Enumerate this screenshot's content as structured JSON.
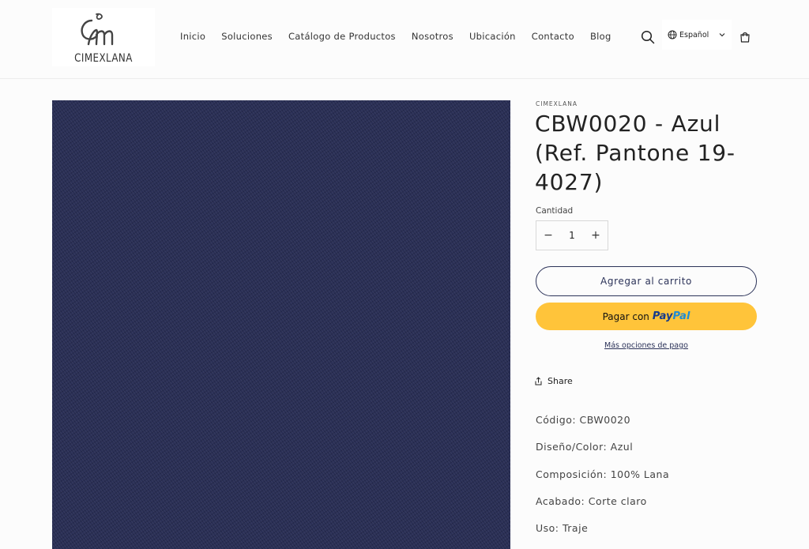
{
  "header": {
    "logo_text": "CIMEXLANA",
    "nav": [
      "Inicio",
      "Soluciones",
      "Catálogo de Productos",
      "Nosotros",
      "Ubicación",
      "Contacto",
      "Blog"
    ],
    "language": "Español",
    "icons": {
      "search": "search-icon",
      "language": "globe-icon",
      "dropdown": "chevron-down-icon",
      "cart": "cart-icon"
    }
  },
  "product": {
    "vendor": "CIMEXLANA",
    "title": "CBW0020 - Azul (Ref. Pantone 19-4027)",
    "image_color": "#2a2f55",
    "quantity_label": "Cantidad",
    "quantity": "1",
    "decrease_label": "−",
    "increase_label": "+",
    "add_to_cart": "Agregar al carrito",
    "paypal_prefix": "Pagar con",
    "paypal_pay": "Pay",
    "paypal_pal": "Pal",
    "more_payment": "Más opciones de pago",
    "share": "Share",
    "details": [
      "Código: CBW0020",
      "Diseño/Color: Azul",
      "Composición: 100% Lana",
      "Acabado: Corte claro",
      "Uso: Traje"
    ]
  },
  "colors": {
    "accent": "#2c3359",
    "paypal": "#ffc43a",
    "background": "#fcfcfc"
  }
}
